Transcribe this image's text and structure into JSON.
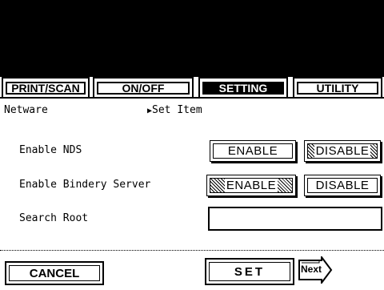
{
  "tabs": [
    {
      "label": "PRINT/SCAN"
    },
    {
      "label": "ON/OFF"
    },
    {
      "label": "SETTING"
    },
    {
      "label": "UTILITY"
    }
  ],
  "header": {
    "section": "Netware",
    "breadcrumb_marker": "▶",
    "breadcrumb": "Set Item"
  },
  "rows": {
    "nds": {
      "label": "Enable NDS",
      "enable": "ENABLE",
      "disable": "DISABLE",
      "selected": "DISABLE"
    },
    "bindery": {
      "label": "Enable Bindery Server",
      "enable": "ENABLE",
      "disable": "DISABLE",
      "selected": "ENABLE"
    },
    "search_root": {
      "label": "Search Root",
      "value": ""
    }
  },
  "footer": {
    "cancel": "CANCEL",
    "set": "SET",
    "next": "Next"
  }
}
